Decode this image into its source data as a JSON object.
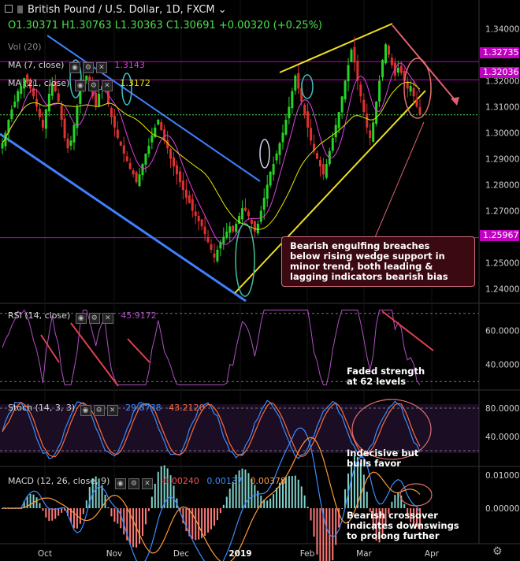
{
  "header": {
    "title": "British Pound / U.S. Dollar, 1D, FXCM",
    "ohlc": "O1.30371  H1.30763  L1.30363  C1.30691  +0.00320 (+0.25%)"
  },
  "indicators": {
    "vol": "Vol (20)",
    "ma7": {
      "label": "MA (7, close)",
      "value": "1.3143"
    },
    "ma21": {
      "label": "MA (21, close)",
      "value": "1.3172"
    },
    "rsi": {
      "label": "RSI (14, close)",
      "value": "45.9172"
    },
    "stoch": {
      "label": "Stoch (14, 3, 3)",
      "k": "29.8738",
      "d": "43.2120"
    },
    "macd": {
      "label": "MACD (12, 26, close, 9)",
      "hist": "-0.00240",
      "macd": "0.00137",
      "signal": "0.00378"
    }
  },
  "price_tags": [
    {
      "value": "1.32735",
      "color": "#c200c2"
    },
    {
      "value": "1.32036",
      "color": "#c200c2"
    },
    {
      "value": "1.25967",
      "color": "#c200c2"
    }
  ],
  "price_axis": [
    "1.34000",
    "1.33000",
    "1.32000",
    "1.31000",
    "1.30000",
    "1.29000",
    "1.28000",
    "1.27000",
    "1.26000",
    "1.25000",
    "1.24000"
  ],
  "rsi_axis": [
    "60.0000",
    "40.0000"
  ],
  "stoch_axis": [
    "80.0000",
    "40.0000"
  ],
  "macd_axis": [
    "0.01000",
    "0.00000"
  ],
  "time_axis": [
    "Oct",
    "Nov",
    "Dec",
    "2019",
    "Feb",
    "Mar",
    "Apr"
  ],
  "annotations": {
    "callout": [
      "Bearish engulfing breaches",
      "below rising wedge support in",
      "minor trend, both leading &",
      "lagging indicators bearish bias"
    ],
    "rsi": [
      "Faded strength",
      "at 62 levels"
    ],
    "stoch": [
      "Indecisive but",
      "bulls favor"
    ],
    "macd": [
      "Bearish crossover",
      "indicates downswings",
      "to prolong further"
    ]
  },
  "chart_data": {
    "type": "candlestick",
    "symbol": "GBPUSD",
    "timeframe": "1D",
    "ylim": [
      1.235,
      1.345
    ],
    "horizontal_levels": [
      1.32735,
      1.32036,
      1.25967
    ],
    "last_close": 1.30691,
    "closes": [
      1.296,
      1.3,
      1.305,
      1.309,
      1.312,
      1.316,
      1.318,
      1.321,
      1.319,
      1.317,
      1.314,
      1.31,
      1.306,
      1.302,
      1.309,
      1.315,
      1.319,
      1.316,
      1.312,
      1.305,
      1.298,
      1.294,
      1.297,
      1.303,
      1.31,
      1.317,
      1.32,
      1.322,
      1.318,
      1.314,
      1.31,
      1.315,
      1.318,
      1.316,
      1.311,
      1.306,
      1.302,
      1.298,
      1.295,
      1.292,
      1.289,
      1.286,
      1.284,
      1.281,
      1.284,
      1.288,
      1.292,
      1.295,
      1.299,
      1.302,
      1.305,
      1.301,
      1.297,
      1.294,
      1.29,
      1.287,
      1.284,
      1.281,
      1.278,
      1.275,
      1.273,
      1.27,
      1.268,
      1.266,
      1.264,
      1.261,
      1.258,
      1.255,
      1.252,
      1.255,
      1.258,
      1.26,
      1.262,
      1.264,
      1.262,
      1.265,
      1.268,
      1.271,
      1.27,
      1.268,
      1.265,
      1.262,
      1.265,
      1.27,
      1.275,
      1.28,
      1.285,
      1.288,
      1.292,
      1.296,
      1.3,
      1.305,
      1.31,
      1.316,
      1.322,
      1.317,
      1.312,
      1.307,
      1.302,
      1.297,
      1.293,
      1.29,
      1.287,
      1.284,
      1.288,
      1.293,
      1.298,
      1.303,
      1.308,
      1.314,
      1.32,
      1.326,
      1.332,
      1.327,
      1.32,
      1.314,
      1.308,
      1.302,
      1.298,
      1.304,
      1.312,
      1.32,
      1.328,
      1.334,
      1.33,
      1.326,
      1.322,
      1.325,
      1.323,
      1.32,
      1.317,
      1.318,
      1.314,
      1.31,
      1.307
    ]
  }
}
